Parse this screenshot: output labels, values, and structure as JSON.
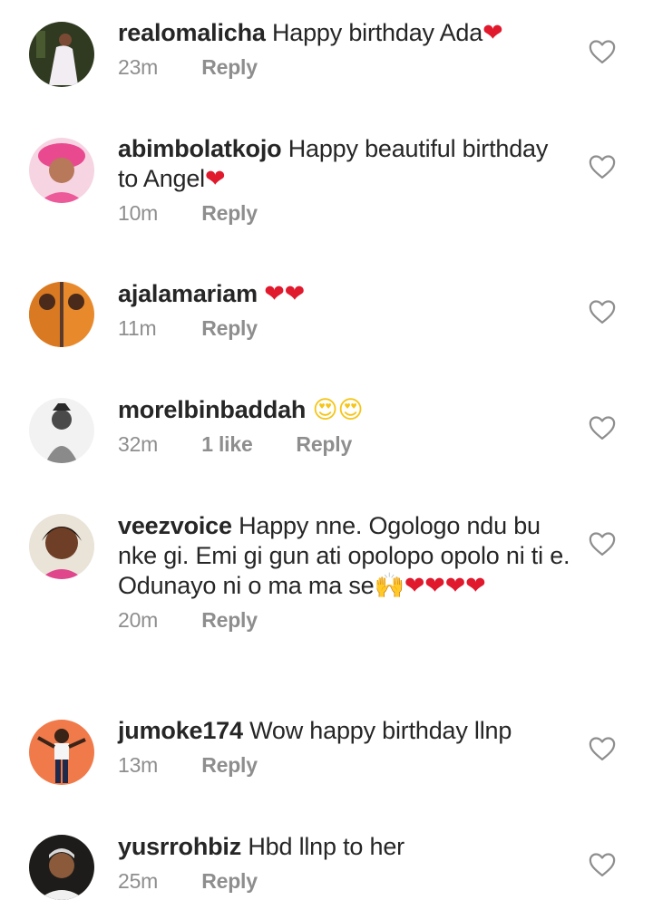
{
  "comments": [
    {
      "username": "realomalicha",
      "text": "Happy birthday Ada",
      "emoji": "❤",
      "time": "23m",
      "likes": "",
      "reply_label": "Reply"
    },
    {
      "username": "abimbolatkojo",
      "text": "Happy beautiful birthday to Angel",
      "emoji": "❤",
      "time": "10m",
      "likes": "",
      "reply_label": "Reply"
    },
    {
      "username": "ajalamariam",
      "text": "",
      "emoji": "❤❤",
      "time": "11m",
      "likes": "",
      "reply_label": "Reply"
    },
    {
      "username": "morelbinbaddah",
      "text": "",
      "emoji": "😍😍",
      "time": "32m",
      "likes": "1 like",
      "reply_label": "Reply"
    },
    {
      "username": "veezvoice",
      "text": "Happy nne. Ogologo ndu bu nke gi. Emi gi gun ati opolopo opolo ni ti e. Odunayo ni o ma ma se",
      "emoji": "🙌❤❤❤❤",
      "time": "20m",
      "likes": "",
      "reply_label": "Reply"
    },
    {
      "username": "jumoke174",
      "text": "Wow happy birthday llnp",
      "emoji": "",
      "time": "13m",
      "likes": "",
      "reply_label": "Reply"
    },
    {
      "username": "yusrrohbiz",
      "text": "Hbd llnp to her",
      "emoji": "",
      "time": "25m",
      "likes": "",
      "reply_label": "Reply"
    }
  ],
  "colors": {
    "primary_text": "#262626",
    "secondary_text": "#8e8e8e",
    "heart_red": "#e0192d"
  },
  "icons": {
    "like": "heart-outline-icon"
  }
}
